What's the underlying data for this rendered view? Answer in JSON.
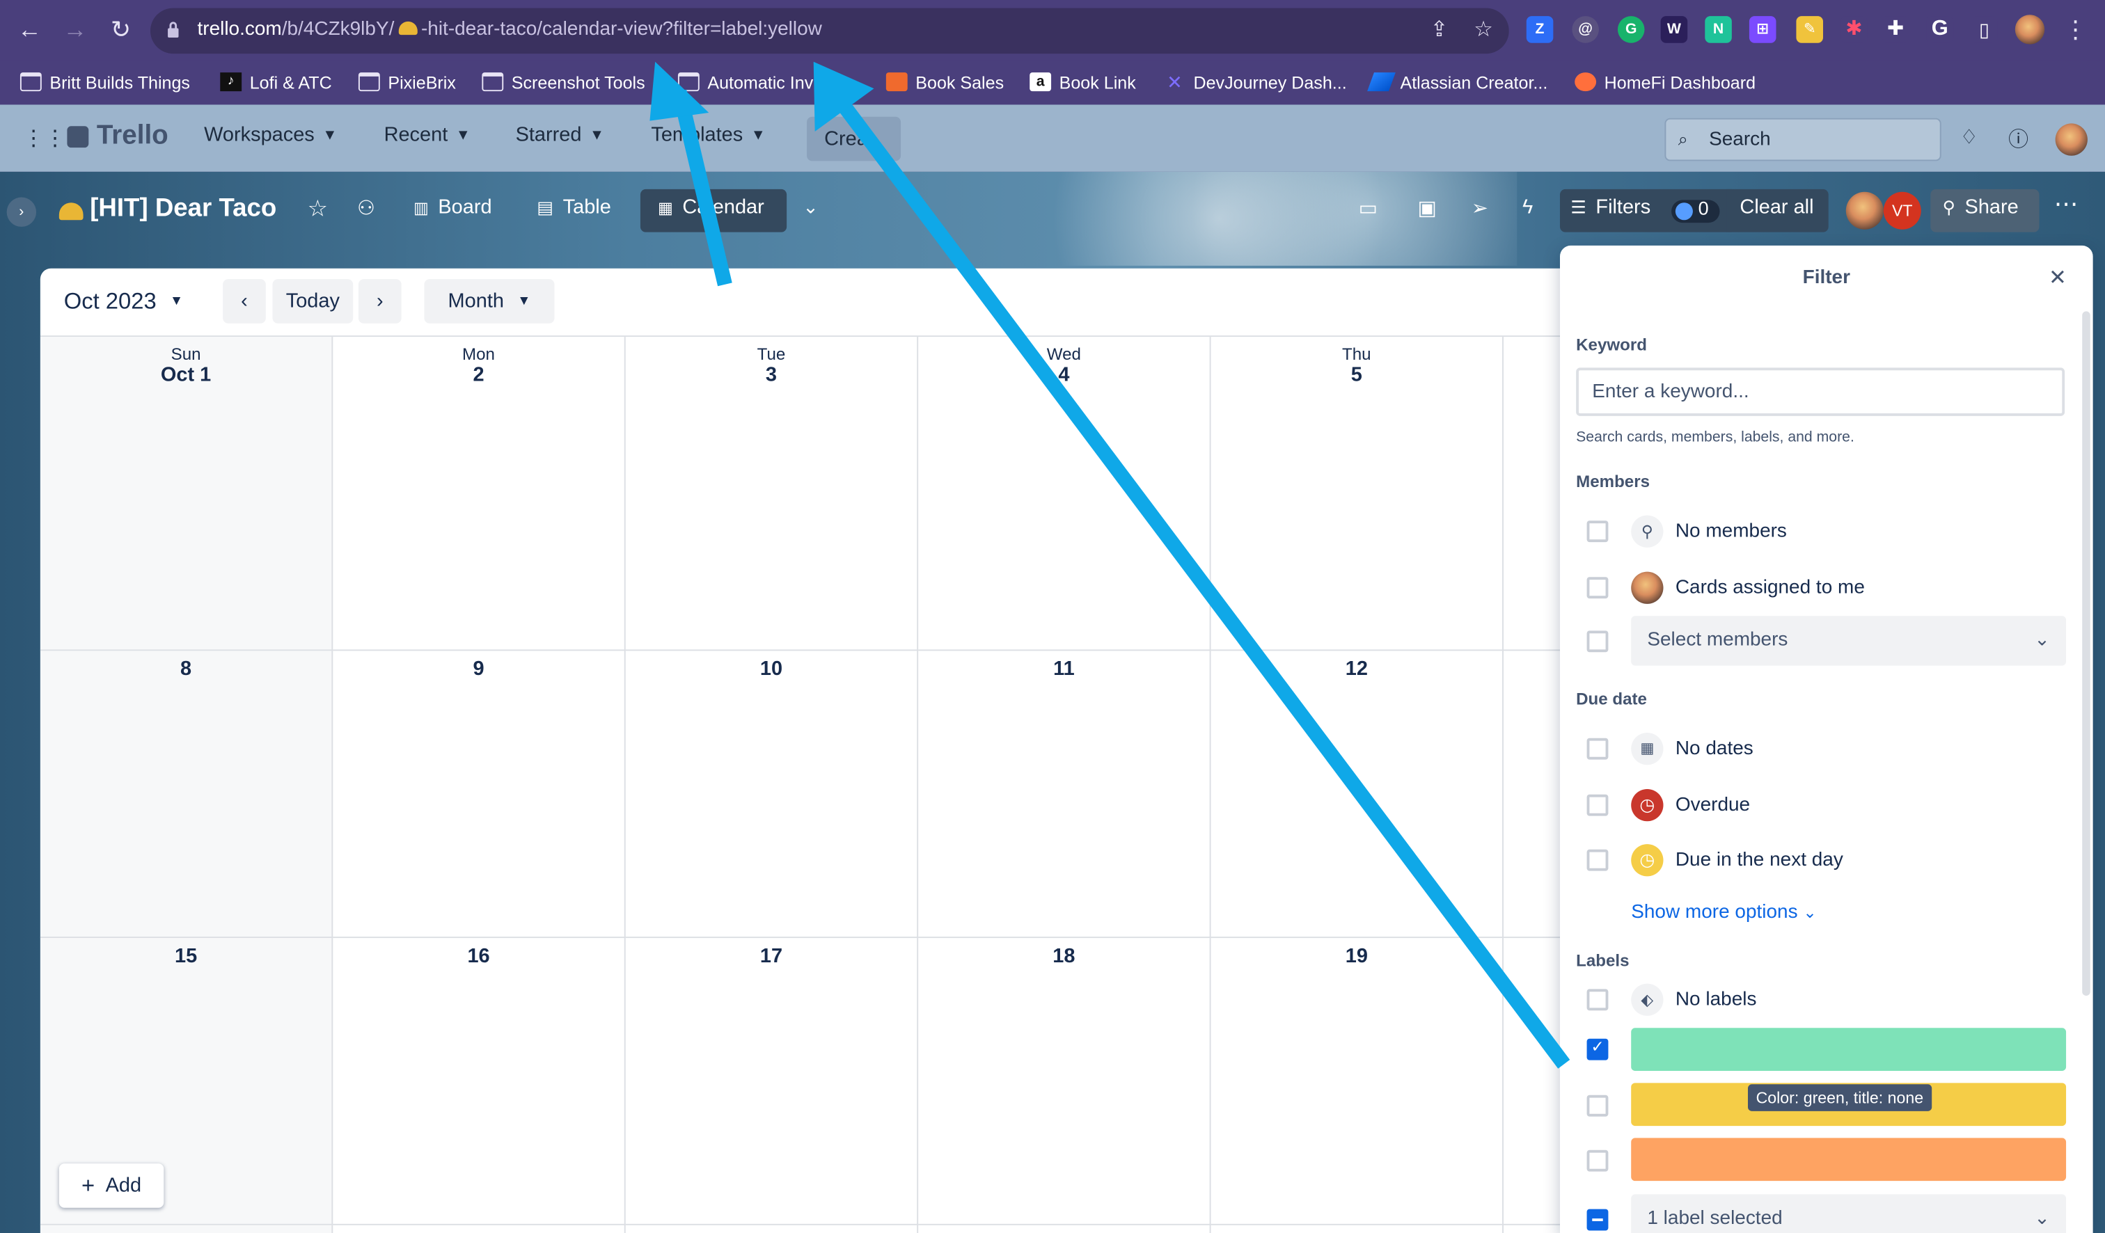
{
  "browser": {
    "url_host": "trello.com",
    "url_path": "/b/4CZk9lbY/",
    "url_rest": "-hit-dear-taco/calendar-view?filter=label:yellow"
  },
  "bookmarks": [
    {
      "label": "Britt Builds Things",
      "icon": "folder-icon"
    },
    {
      "label": "Lofi & ATC",
      "icon": "music-icon"
    },
    {
      "label": "PixieBrix",
      "icon": "folder-icon"
    },
    {
      "label": "Screenshot Tools",
      "icon": "folder-icon"
    },
    {
      "label": "Automatic Inv",
      "icon": "folder-icon"
    },
    {
      "label": "Book Sales",
      "icon": "book-icon"
    },
    {
      "label": "Book Link",
      "icon": "amazon-icon"
    },
    {
      "label": "DevJourney Dash...",
      "icon": "devjourney-icon"
    },
    {
      "label": "Atlassian Creator...",
      "icon": "atlassian-icon"
    },
    {
      "label": "HomeFi Dashboard",
      "icon": "homefi-icon"
    }
  ],
  "trello_header": {
    "logo": "Trello",
    "menus": [
      "Workspaces",
      "Recent",
      "Starred",
      "Templates"
    ],
    "create": "Crea",
    "search_placeholder": "Search"
  },
  "board": {
    "title": "[HIT] Dear Taco",
    "views": [
      "Board",
      "Table",
      "Calendar"
    ],
    "filters_label": "Filters",
    "filter_count": "0",
    "clear_all": "Clear all",
    "member_initials": "VT",
    "share": "Share"
  },
  "calendar": {
    "month_label": "Oct 2023",
    "today": "Today",
    "view_mode": "Month",
    "add": "Add",
    "weekdays": [
      "Sun",
      "Mon",
      "Tue",
      "Wed",
      "Thu"
    ],
    "first_row": [
      "Oct 1",
      "2",
      "3",
      "4",
      "5"
    ],
    "rows": [
      [
        "8",
        "9",
        "10",
        "11",
        "12"
      ],
      [
        "15",
        "16",
        "17",
        "18",
        "19"
      ]
    ]
  },
  "filter": {
    "title": "Filter",
    "keyword_label": "Keyword",
    "keyword_placeholder": "Enter a keyword...",
    "keyword_hint": "Search cards, members, labels, and more.",
    "members_label": "Members",
    "members_options": [
      "No members",
      "Cards assigned to me"
    ],
    "select_members": "Select members",
    "due_label": "Due date",
    "due_options": [
      "No dates",
      "Overdue",
      "Due in the next day"
    ],
    "show_more": "Show more options",
    "labels_label": "Labels",
    "no_labels": "No labels",
    "label_colors": [
      "#7ee2b8",
      "#f5cd47",
      "#fea362"
    ],
    "tooltip": "Color: green, title: none",
    "labels_selected": "1 label selected"
  },
  "colors": {
    "arrow": "#0fa8e8",
    "browser_bg": "#4a3f7c",
    "trello_header": "#9cb4cc",
    "accent": "#0c66e4"
  }
}
